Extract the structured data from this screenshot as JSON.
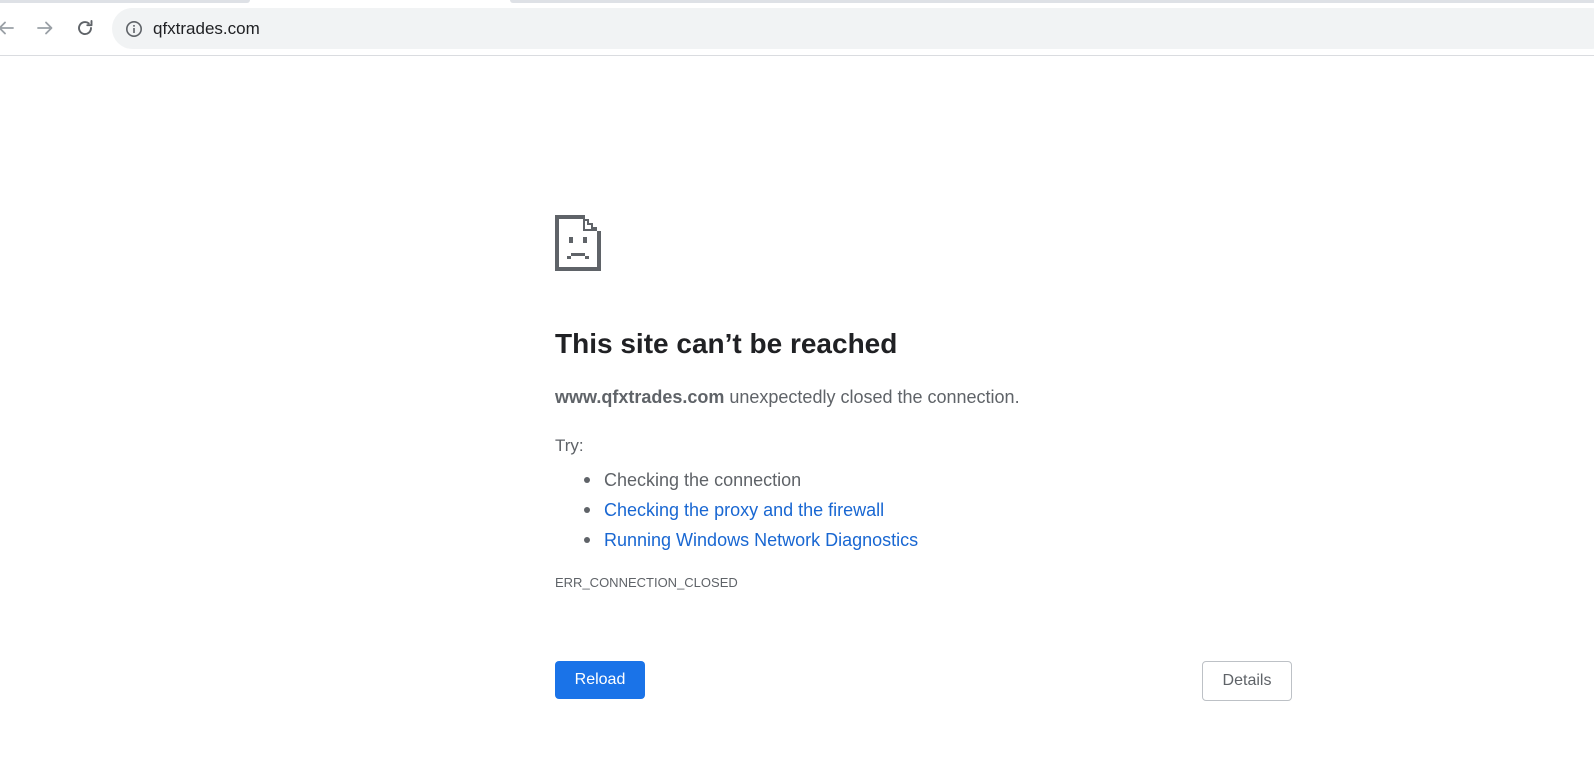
{
  "browser": {
    "url": "qfxtrades.com",
    "back_icon": "back-arrow-icon",
    "forward_icon": "forward-arrow-icon",
    "reload_icon": "reload-icon",
    "site_info_icon": "info-icon"
  },
  "error_page": {
    "icon": "sad-page-icon",
    "title": "This site can’t be reached",
    "summary_domain": "www.qfxtrades.com",
    "summary_text": " unexpectedly closed the connection.",
    "try_label": "Try:",
    "suggestions": [
      {
        "text": "Checking the connection",
        "link": false
      },
      {
        "text": "Checking the proxy and the firewall",
        "link": true
      },
      {
        "text": "Running Windows Network Diagnostics",
        "link": true
      }
    ],
    "error_code": "ERR_CONNECTION_CLOSED",
    "reload_label": "Reload",
    "details_label": "Details"
  },
  "colors": {
    "accent": "#1a73e8",
    "link": "#1967d2",
    "text_primary": "#202124",
    "text_secondary": "#5f6368",
    "omnibox_bg": "#f1f3f4"
  }
}
